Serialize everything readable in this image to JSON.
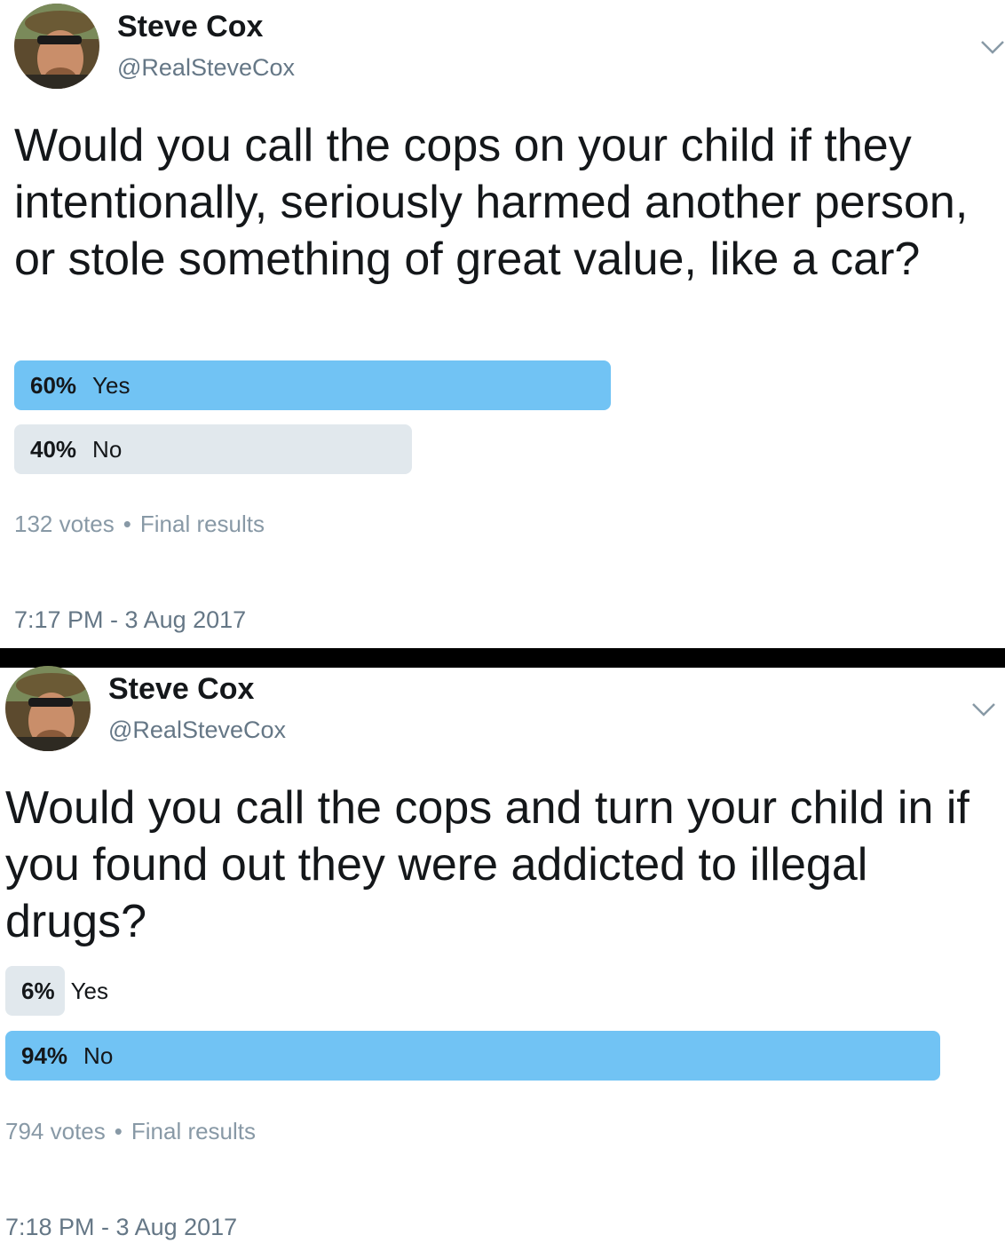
{
  "colors": {
    "poll_winner": "#71c3f4",
    "poll_other": "#e1e8ed",
    "text_primary": "#14171a",
    "text_secondary": "#657786",
    "divider": "#000000"
  },
  "tweets": [
    {
      "author": {
        "display_name": "Steve Cox",
        "handle": "@RealSteveCox",
        "avatar_icon": "avatar-photo"
      },
      "text": "Would you call the cops on your child if they intentionally, seriously harmed another person, or stole something of great value, like a car?",
      "poll": {
        "options": [
          {
            "percent_label": "60%",
            "choice": "Yes",
            "percent": 60,
            "winner": true
          },
          {
            "percent_label": "40%",
            "choice": "No",
            "percent": 40,
            "winner": false
          }
        ],
        "votes": "132 votes",
        "separator": "•",
        "status": "Final results"
      },
      "timestamp": "7:17 PM - 3 Aug 2017",
      "menu_icon": "chevron-down-icon"
    },
    {
      "author": {
        "display_name": "Steve Cox",
        "handle": "@RealSteveCox",
        "avatar_icon": "avatar-photo"
      },
      "text": "Would you call the cops and turn your child in if you found out they were addicted to illegal drugs?",
      "poll": {
        "options": [
          {
            "percent_label": "6%",
            "choice": "Yes",
            "percent": 6,
            "winner": false
          },
          {
            "percent_label": "94%",
            "choice": "No",
            "percent": 94,
            "winner": true
          }
        ],
        "votes": "794 votes",
        "separator": "•",
        "status": "Final results"
      },
      "timestamp": "7:18 PM - 3 Aug 2017",
      "menu_icon": "chevron-down-icon"
    }
  ]
}
